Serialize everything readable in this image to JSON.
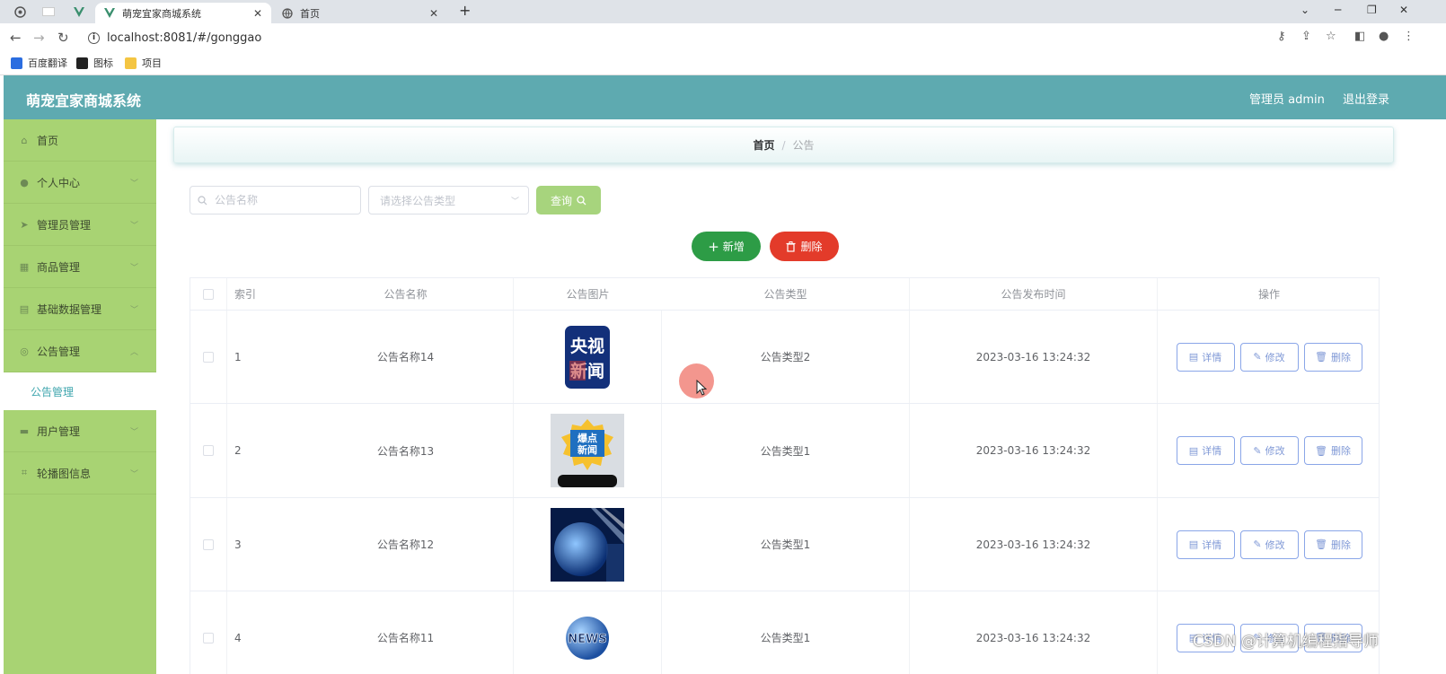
{
  "browser": {
    "tabs": [
      {
        "title": "萌宠宜家商城系统",
        "active": true
      },
      {
        "title": "首页",
        "active": false
      }
    ],
    "url": "localhost:8081/#/gonggao",
    "bookmarks": [
      "百度翻译",
      "图标",
      "项目"
    ]
  },
  "header": {
    "title": "萌宠宜家商城系统",
    "user": "管理员 admin",
    "logout": "退出登录",
    "color": "#5eaab0"
  },
  "sidebar": {
    "color": "#a8d373",
    "items": [
      {
        "label": "首页",
        "icon": "home-icon"
      },
      {
        "label": "个人中心",
        "icon": "user-icon"
      },
      {
        "label": "管理员管理",
        "icon": "send-icon"
      },
      {
        "label": "商品管理",
        "icon": "grid-icon"
      },
      {
        "label": "基础数据管理",
        "icon": "chart-icon"
      },
      {
        "label": "公告管理",
        "icon": "compass-icon"
      },
      {
        "label": "用户管理",
        "icon": "truck-icon"
      },
      {
        "label": "轮播图信息",
        "icon": "crop-icon"
      }
    ],
    "submenu_label": "公告管理"
  },
  "breadcrumb": {
    "home": "首页",
    "current": "公告"
  },
  "search": {
    "name_placeholder": "公告名称",
    "type_placeholder": "请选择公告类型",
    "query_label": "查询"
  },
  "actions": {
    "add_label": "新增",
    "delete_label": "删除"
  },
  "table": {
    "headers": {
      "index": "索引",
      "name": "公告名称",
      "image": "公告图片",
      "type": "公告类型",
      "time": "公告发布时间",
      "ops": "操作"
    },
    "rows": [
      {
        "index": "1",
        "name": "公告名称14",
        "image": "cctv-news-logo",
        "type": "公告类型2",
        "time": "2023-03-16 13:24:32"
      },
      {
        "index": "2",
        "name": "公告名称13",
        "image": "hot-news-logo",
        "type": "公告类型1",
        "time": "2023-03-16 13:24:32"
      },
      {
        "index": "3",
        "name": "公告名称12",
        "image": "globe-broadcast-image",
        "type": "公告类型1",
        "time": "2023-03-16 13:24:32"
      },
      {
        "index": "4",
        "name": "公告名称11",
        "image": "news-globe-logo",
        "type": "公告类型1",
        "time": "2023-03-16 13:24:32"
      }
    ],
    "op_labels": {
      "detail": "详情",
      "edit": "修改",
      "delete": "删除"
    }
  },
  "watermark": "CSDN @计算机编程指导师"
}
